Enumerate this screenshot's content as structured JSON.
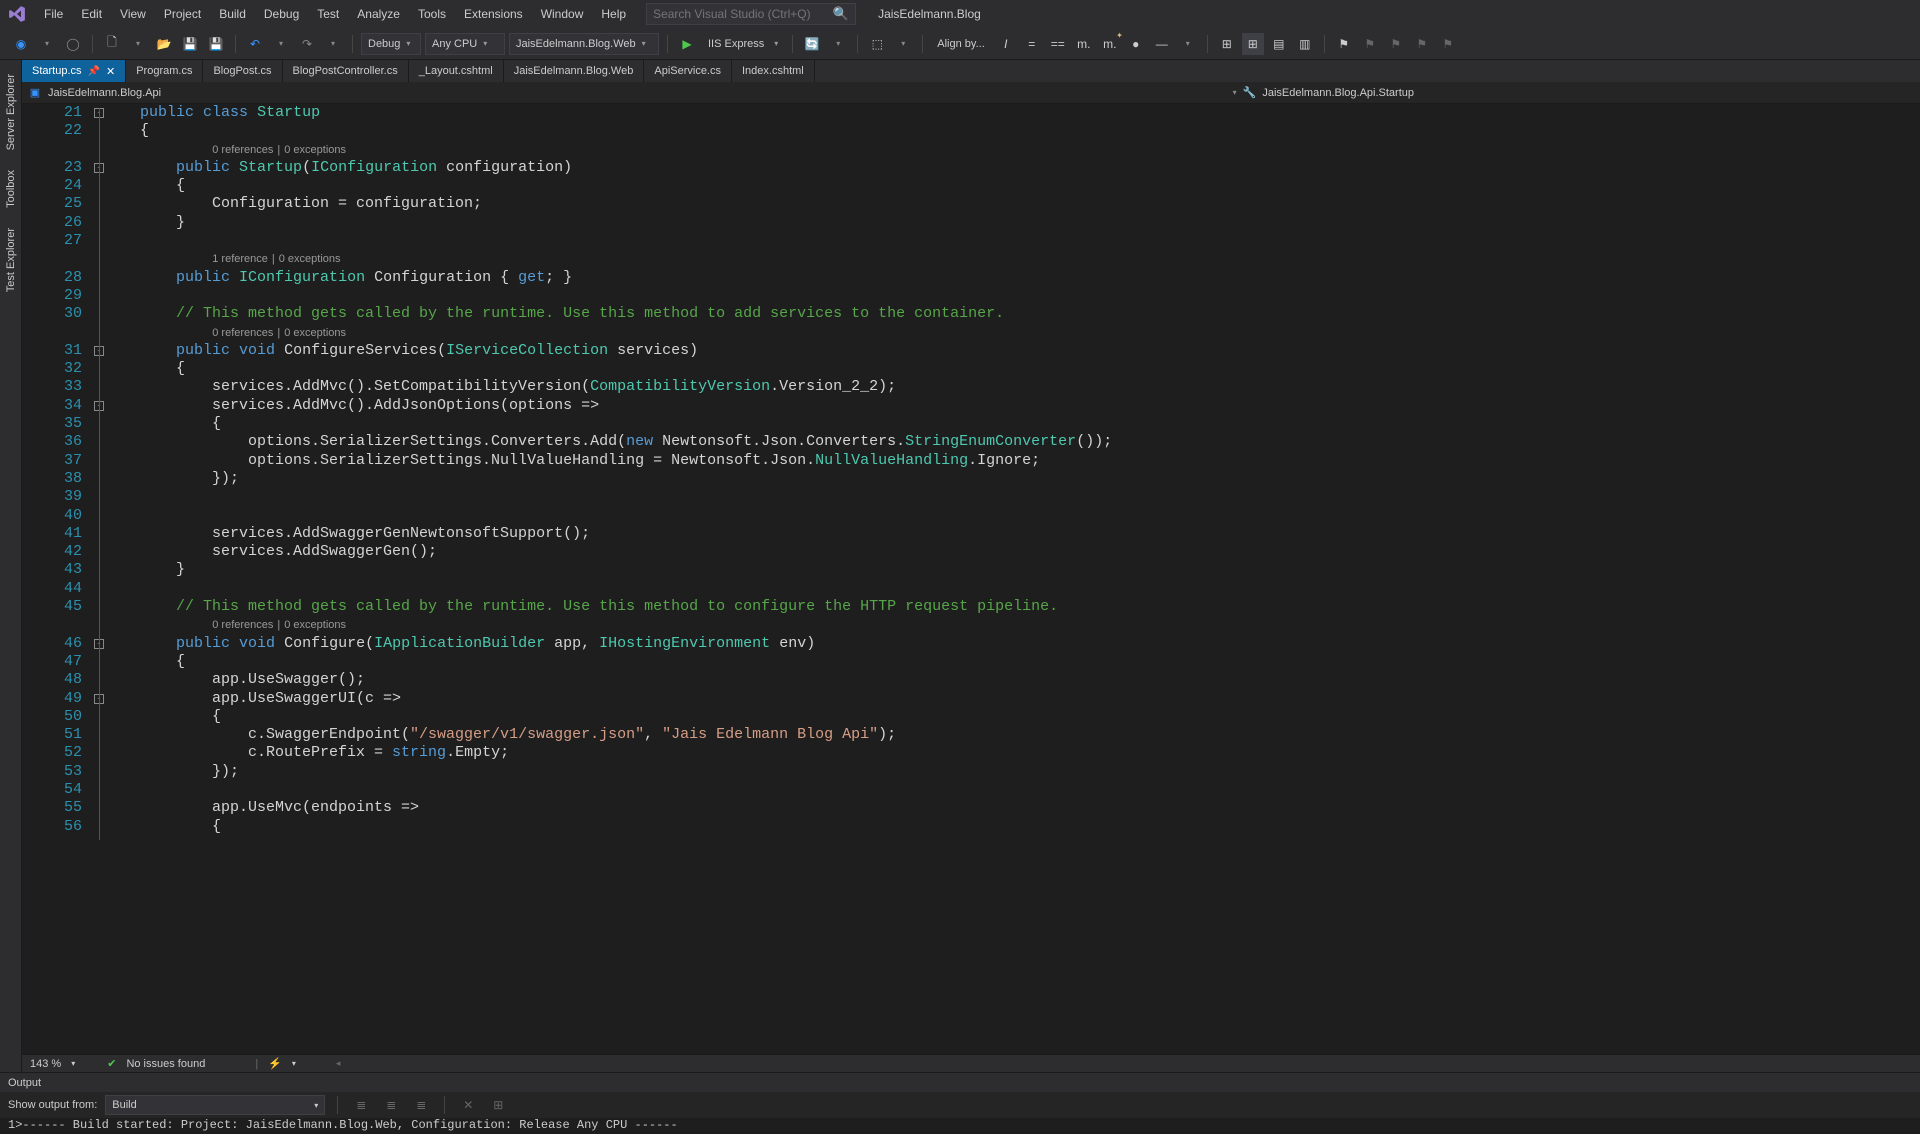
{
  "menu": [
    "File",
    "Edit",
    "View",
    "Project",
    "Build",
    "Debug",
    "Test",
    "Analyze",
    "Tools",
    "Extensions",
    "Window",
    "Help"
  ],
  "search_placeholder": "Search Visual Studio (Ctrl+Q)",
  "solution_name": "JaisEdelmann.Blog",
  "toolbar": {
    "config": "Debug",
    "platform": "Any CPU",
    "startup": "JaisEdelmann.Blog.Web",
    "run_label": "IIS Express",
    "align_label": "Align by..."
  },
  "sidebar_tabs": [
    "Server Explorer",
    "Toolbox",
    "Test Explorer"
  ],
  "doc_tabs": [
    {
      "label": "Startup.cs",
      "active": true,
      "pinned": true,
      "closable": true
    },
    {
      "label": "Program.cs"
    },
    {
      "label": "BlogPost.cs"
    },
    {
      "label": "BlogPostController.cs"
    },
    {
      "label": "_Layout.cshtml"
    },
    {
      "label": "JaisEdelmann.Blog.Web"
    },
    {
      "label": "ApiService.cs"
    },
    {
      "label": "Index.cshtml"
    }
  ],
  "nav": {
    "project": "JaisEdelmann.Blog.Api",
    "class": "JaisEdelmann.Blog.Api.Startup"
  },
  "codelens": {
    "zeroRef": "0 references",
    "zeroEx": "0 exceptions",
    "oneRef": "1 reference"
  },
  "line_start": 21,
  "code_lines": [
    {
      "ln": 21,
      "type": "code",
      "html": "<span class=\"kw\">public</span> <span class=\"kw\">class</span> <span class=\"cls\">Startup</span>"
    },
    {
      "ln": 22,
      "type": "code",
      "html": "{"
    },
    {
      "type": "lens",
      "refs": "0 references",
      "ex": "0 exceptions",
      "indent": 1
    },
    {
      "ln": 23,
      "type": "code",
      "html": "    <span class=\"kw\">public</span> <span class=\"cls\">Startup</span>(<span class=\"cls\">IConfiguration</span> configuration)"
    },
    {
      "ln": 24,
      "type": "code",
      "html": "    {"
    },
    {
      "ln": 25,
      "type": "code",
      "html": "        Configuration = configuration;"
    },
    {
      "ln": 26,
      "type": "code",
      "html": "    }"
    },
    {
      "ln": 27,
      "type": "code",
      "html": ""
    },
    {
      "type": "lens",
      "refs": "1 reference",
      "ex": "0 exceptions",
      "indent": 1
    },
    {
      "ln": 28,
      "type": "code",
      "html": "    <span class=\"kw\">public</span> <span class=\"cls\">IConfiguration</span> Configuration { <span class=\"kw\">get</span>; }"
    },
    {
      "ln": 29,
      "type": "code",
      "html": ""
    },
    {
      "ln": 30,
      "type": "code",
      "html": "    <span class=\"comment\">// This method gets called by the runtime. Use this method to add services to the container.</span>"
    },
    {
      "type": "lens",
      "refs": "0 references",
      "ex": "0 exceptions",
      "indent": 1
    },
    {
      "ln": 31,
      "type": "code",
      "html": "    <span class=\"kw\">public</span> <span class=\"kw\">void</span> <span class=\"ident\">ConfigureServices</span>(<span class=\"cls\">IServiceCollection</span> services)"
    },
    {
      "ln": 32,
      "type": "code",
      "html": "    {"
    },
    {
      "ln": 33,
      "type": "code",
      "html": "        services.AddMvc().SetCompatibilityVersion(<span class=\"cls\">CompatibilityVersion</span>.Version_2_2);"
    },
    {
      "ln": 34,
      "type": "code",
      "html": "        services.AddMvc().AddJsonOptions(options =&gt;"
    },
    {
      "ln": 35,
      "type": "code",
      "html": "        {"
    },
    {
      "ln": 36,
      "type": "code",
      "html": "            options.SerializerSettings.Converters.Add(<span class=\"kw\">new</span> Newtonsoft.Json.Converters.<span class=\"cls\">StringEnumConverter</span>());"
    },
    {
      "ln": 37,
      "type": "code",
      "html": "            options.SerializerSettings.NullValueHandling = Newtonsoft.Json.<span class=\"cls\">NullValueHandling</span>.Ignore;"
    },
    {
      "ln": 38,
      "type": "code",
      "html": "        });"
    },
    {
      "ln": 39,
      "type": "code",
      "html": ""
    },
    {
      "ln": 40,
      "type": "code",
      "html": ""
    },
    {
      "ln": 41,
      "type": "code",
      "html": "        services.AddSwaggerGenNewtonsoftSupport();"
    },
    {
      "ln": 42,
      "type": "code",
      "html": "        services.AddSwaggerGen();"
    },
    {
      "ln": 43,
      "type": "code",
      "html": "    }"
    },
    {
      "ln": 44,
      "type": "code",
      "html": ""
    },
    {
      "ln": 45,
      "type": "code",
      "html": "    <span class=\"comment\">// This method gets called by the runtime. Use this method to configure the HTTP request pipeline.</span>"
    },
    {
      "type": "lens",
      "refs": "0 references",
      "ex": "0 exceptions",
      "indent": 1
    },
    {
      "ln": 46,
      "type": "code",
      "html": "    <span class=\"kw\">public</span> <span class=\"kw\">void</span> <span class=\"ident\">Configure</span>(<span class=\"cls\">IApplicationBuilder</span> app, <span class=\"cls\">IHostingEnvironment</span> env)"
    },
    {
      "ln": 47,
      "type": "code",
      "html": "    {"
    },
    {
      "ln": 48,
      "type": "code",
      "html": "        app.UseSwagger();"
    },
    {
      "ln": 49,
      "type": "code",
      "html": "        app.UseSwaggerUI(c =&gt;"
    },
    {
      "ln": 50,
      "type": "code",
      "html": "        {"
    },
    {
      "ln": 51,
      "type": "code",
      "html": "            c.SwaggerEndpoint(<span class=\"str\">\"/swagger/v1/swagger.json\"</span>, <span class=\"str\">\"Jais Edelmann Blog Api\"</span>);"
    },
    {
      "ln": 52,
      "type": "code",
      "html": "            c.RoutePrefix = <span class=\"kw\">string</span>.Empty;"
    },
    {
      "ln": 53,
      "type": "code",
      "html": "        });"
    },
    {
      "ln": 54,
      "type": "code",
      "html": ""
    },
    {
      "ln": 55,
      "type": "code",
      "html": "        app.UseMvc(endpoints =&gt;"
    },
    {
      "ln": 56,
      "type": "code",
      "html": "        {"
    }
  ],
  "zoom": "143 %",
  "issues": "No issues found",
  "output": {
    "title": "Output",
    "from_label": "Show output from:",
    "from_value": "Build",
    "content": "1>------ Build started: Project: JaisEdelmann.Blog.Web, Configuration: Release Any CPU ------"
  }
}
